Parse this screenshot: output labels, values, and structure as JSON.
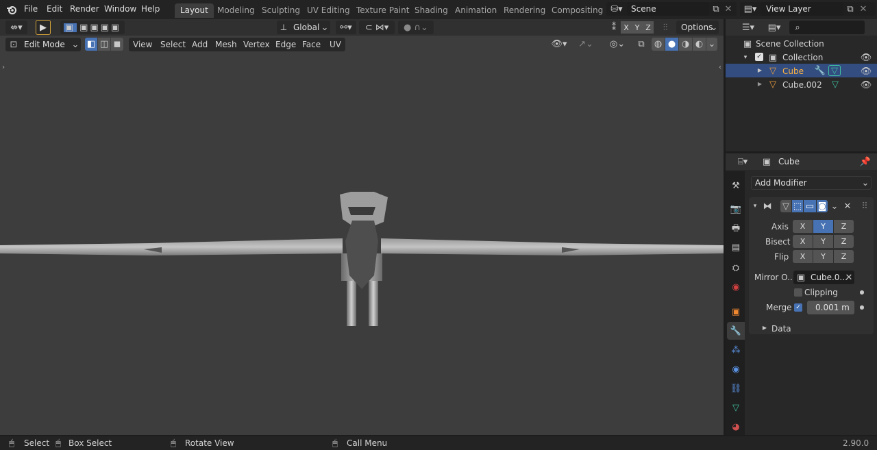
{
  "menu": [
    "File",
    "Edit",
    "Render",
    "Window",
    "Help"
  ],
  "workspaces": [
    "Layout",
    "Modeling",
    "Sculpting",
    "UV Editing",
    "Texture Paint",
    "Shading",
    "Animation",
    "Rendering",
    "Compositing"
  ],
  "scene": "Scene",
  "view_layer": "View Layer",
  "toolbar": {
    "orientation": "Global",
    "options": "Options",
    "x": "X",
    "y": "Y",
    "z": "Z"
  },
  "header": {
    "mode": "Edit Mode",
    "menus": [
      "View",
      "Select",
      "Add",
      "Mesh",
      "Vertex",
      "Edge",
      "Face",
      "UV"
    ]
  },
  "outliner": {
    "items": [
      {
        "label": "Scene Collection"
      },
      {
        "label": "Collection"
      },
      {
        "label": "Cube"
      },
      {
        "label": "Cube.002"
      }
    ]
  },
  "properties": {
    "object": "Cube",
    "add_modifier": "Add Modifier",
    "axis_label": "Axis",
    "bisect_label": "Bisect",
    "flip_label": "Flip",
    "mirror_label": "Mirror O...",
    "mirror_value": "Cube.0...",
    "clipping": "Clipping",
    "merge_label": "Merge",
    "merge_value": "0.001 m",
    "data": "Data",
    "x": "X",
    "y": "Y",
    "z": "Z"
  },
  "status": {
    "select": "Select",
    "box_select": "Box Select",
    "rotate": "Rotate View",
    "call_menu": "Call Menu",
    "version": "2.90.0"
  }
}
